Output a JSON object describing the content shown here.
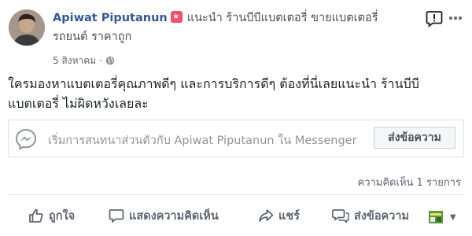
{
  "post": {
    "author": "Apiwat Piputanun",
    "action_text": "แนะนำ ร้านบีบีแบตเตอรี่ ขายแบตเตอรี่",
    "action_text_line2": "รถยนต์ ราคาถูก",
    "date": "5 สิงหาคม",
    "separator": "·",
    "body_line1": "ใครมองหาแบตเตอรี่คุณภาพดีๆ และการบริการดีๆ ต้องที่นี่เลยแนะนำ ร้านบีบี",
    "body_line2": "แบตเตอรี่ ไม่ผิดหวังเลยละ"
  },
  "messenger_cta": {
    "text": "เริ่มการสนทนาส่วนตัวกับ Apiwat Piputanun ใน Messenger",
    "button_label": "ส่งข้อความ"
  },
  "comment_count": "ความคิดเห็น 1 รายการ",
  "actions": {
    "like": "ถูกใจ",
    "comment": "แสดงความคิดเห็น",
    "share": "แชร์",
    "send": "ส่งข้อความ"
  },
  "icons": {
    "header_messenger": "message-alert-icon",
    "more": "more-icon",
    "globe": "globe-icon",
    "cta": "messenger-icon"
  },
  "colors": {
    "author_link": "#365899",
    "badge": "#f25268",
    "muted": "#616770"
  }
}
